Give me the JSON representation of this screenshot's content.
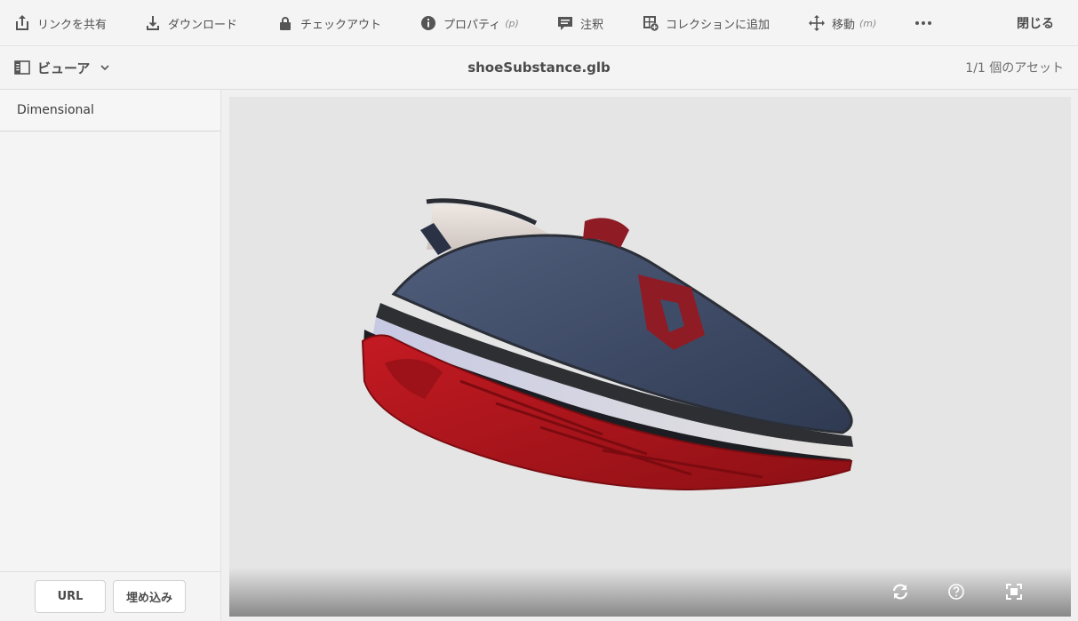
{
  "toolbar": {
    "share_link": "リンクを共有",
    "download": "ダウンロード",
    "checkout": "チェックアウト",
    "properties": "プロパティ",
    "properties_hint": "(p)",
    "annotate": "注釈",
    "add_to_collection": "コレクションに追加",
    "move": "移動",
    "move_hint": "(m)",
    "close": "閉じる"
  },
  "subbar": {
    "viewer_label": "ビューア",
    "filename": "shoeSubstance.glb",
    "asset_count": "1/1 個のアセット"
  },
  "rail": {
    "items": [
      {
        "label": "Dimensional"
      }
    ]
  },
  "footer": {
    "url_button": "URL",
    "embed_button": "埋め込み"
  },
  "icons": {
    "share": "share-icon",
    "download": "download-icon",
    "checkout": "lock-icon",
    "properties": "info-icon",
    "annotate": "comment-icon",
    "collection": "add-collection-icon",
    "move": "move-icon",
    "more": "more-icon",
    "rail": "rail-icon",
    "chevron": "chevron-down-icon",
    "reset": "refresh-icon",
    "help": "help-icon",
    "fullscreen": "fullscreen-icon"
  },
  "colors": {
    "background": "#f4f4f4",
    "viewer_background": "#e5e5e5",
    "shoe_upper": "#3e4c68",
    "shoe_sole": "#b3141c"
  }
}
